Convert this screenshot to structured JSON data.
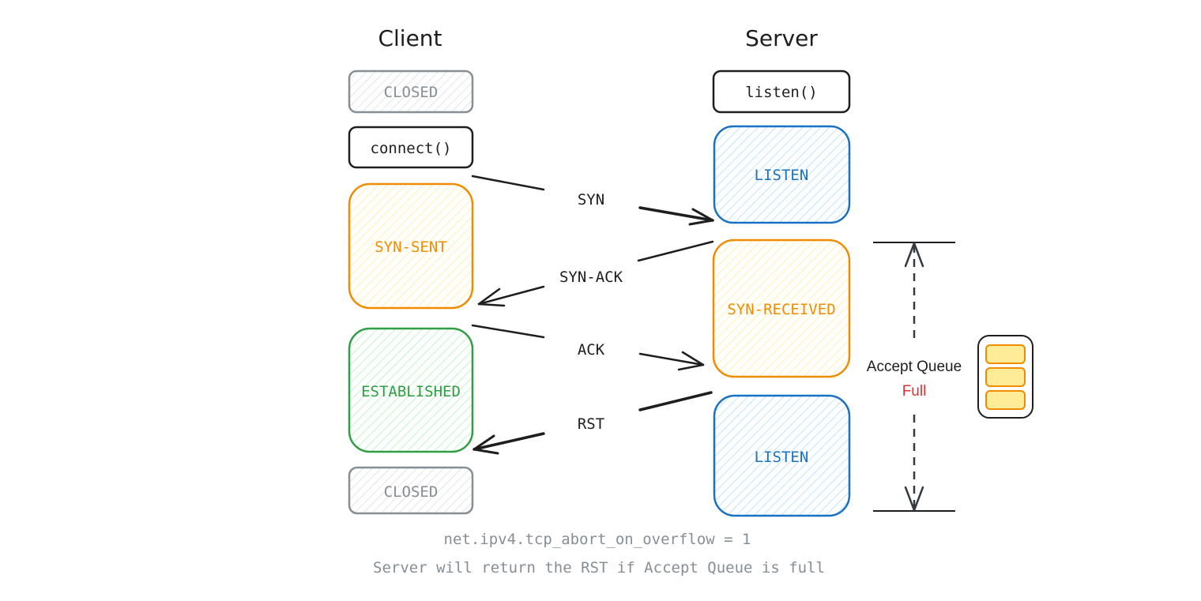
{
  "columns": {
    "client": "Client",
    "server": "Server"
  },
  "client_states": [
    {
      "label": "CLOSED",
      "color": "#868e96"
    },
    {
      "label": "connect()",
      "color": "#1e1e1e"
    },
    {
      "label": "SYN-SENT",
      "color": "#f08c00"
    },
    {
      "label": "ESTABLISHED",
      "color": "#2f9e44"
    },
    {
      "label": "CLOSED",
      "color": "#868e96"
    }
  ],
  "server_states": [
    {
      "label": "listen()",
      "color": "#1e1e1e"
    },
    {
      "label": "LISTEN",
      "color": "#1971c2"
    },
    {
      "label": "SYN-RECEIVED",
      "color": "#f08c00"
    },
    {
      "label": "LISTEN",
      "color": "#1971c2"
    }
  ],
  "messages": [
    {
      "label": "SYN",
      "direction": "client-to-server",
      "color": "#1e1e1e"
    },
    {
      "label": "SYN-ACK",
      "direction": "server-to-client",
      "color": "#1e1e1e"
    },
    {
      "label": "ACK",
      "direction": "client-to-server",
      "color": "#1e1e1e"
    },
    {
      "label": "RST",
      "direction": "server-to-client",
      "color": "#e03131"
    }
  ],
  "accept_queue": {
    "label": "Accept Queue",
    "status": "Full",
    "status_color": "#e03131",
    "slots_filled": 3,
    "slots_total": 3
  },
  "notes": {
    "sysctl": "net.ipv4.tcp_abort_on_overflow = 1",
    "explanation": "Server will return the RST if Accept Queue is full"
  }
}
